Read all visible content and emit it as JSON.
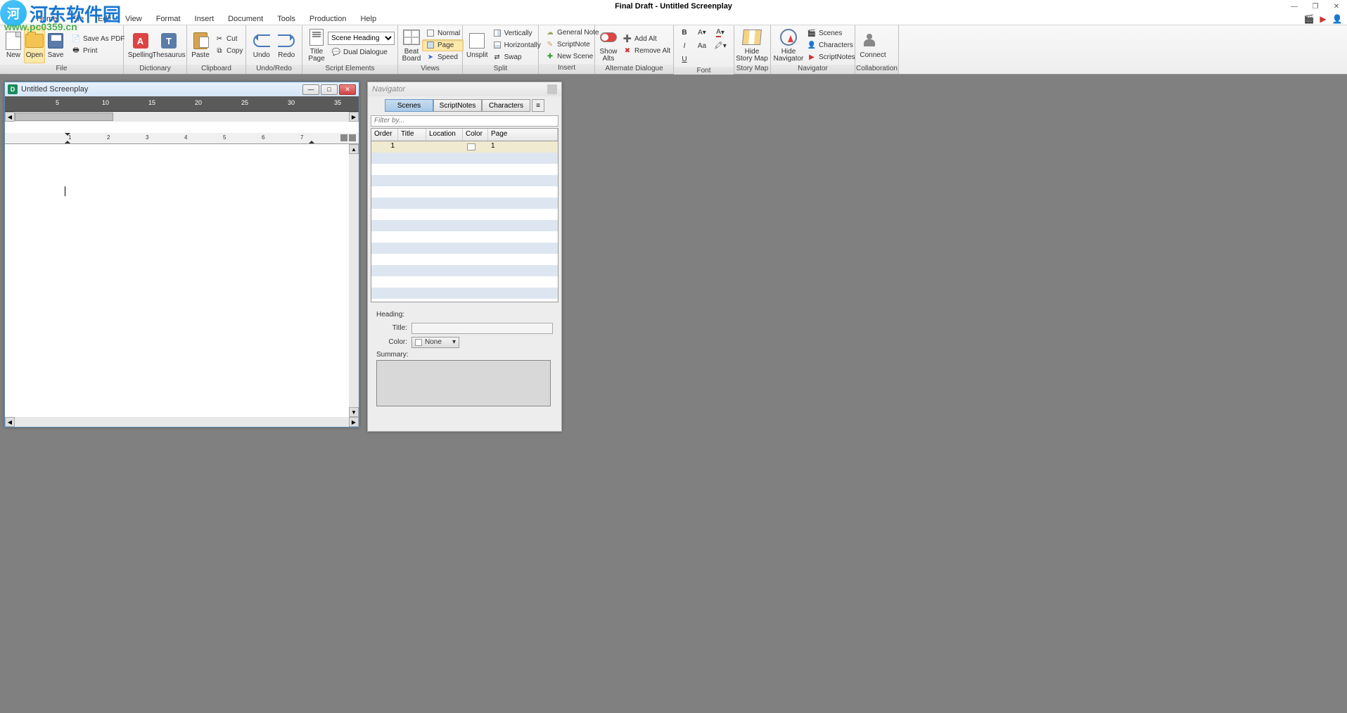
{
  "app": {
    "title": "Final Draft - Untitled Screenplay"
  },
  "watermark": {
    "brand": "河东软件园",
    "url": "www.pc0359.cn"
  },
  "menu": {
    "items": [
      "Home",
      "File",
      "Edit",
      "View",
      "Format",
      "Insert",
      "Document",
      "Tools",
      "Production",
      "Help"
    ]
  },
  "ribbon": {
    "file": {
      "label": "File",
      "new": "New",
      "open": "Open",
      "save": "Save",
      "save_as_pdf": "Save As PDF",
      "print": "Print"
    },
    "dictionary": {
      "label": "Dictionary",
      "spelling": "Spelling",
      "thesaurus": "Thesaurus"
    },
    "clipboard": {
      "label": "Clipboard",
      "paste": "Paste",
      "cut": "Cut",
      "copy": "Copy"
    },
    "undoredo": {
      "label": "Undo/Redo",
      "undo": "Undo",
      "redo": "Redo"
    },
    "script_elements": {
      "label": "Script Elements",
      "title_page": "Title\nPage",
      "element_select": "Scene Heading",
      "dual_dialogue": "Dual Dialogue"
    },
    "views": {
      "label": "Views",
      "beat_board": "Beat\nBoard",
      "normal": "Normal",
      "page": "Page",
      "speed": "Speed"
    },
    "split": {
      "label": "Split",
      "unsplit": "Unsplit",
      "vertically": "Vertically",
      "horizontally": "Horizontally",
      "swap": "Swap"
    },
    "insert": {
      "label": "Insert",
      "general_note": "General Note",
      "script_note": "ScriptNote",
      "new_scene": "New Scene"
    },
    "alternate_dialogue": {
      "label": "Alternate Dialogue",
      "show_alts": "Show\nAlts",
      "add_alt": "Add Alt",
      "remove_alt": "Remove Alt"
    },
    "font": {
      "label": "Font"
    },
    "story_map": {
      "label": "Story Map",
      "hide": "Hide\nStory Map"
    },
    "navigator": {
      "label": "Navigator",
      "hide_nav": "Hide\nNavigator",
      "scenes": "Scenes",
      "characters": "Characters",
      "scriptnotes": "ScriptNotes"
    },
    "collaboration": {
      "label": "Collaboration",
      "connect": "Connect"
    }
  },
  "doc": {
    "title": "Untitled Screenplay",
    "ruler_top": [
      "5",
      "10",
      "15",
      "20",
      "25",
      "30",
      "35"
    ],
    "ruler2": [
      "1",
      "2",
      "3",
      "4",
      "5",
      "6",
      "7"
    ]
  },
  "navigator_panel": {
    "title": "Navigator",
    "tabs": {
      "scenes": "Scenes",
      "scriptnotes": "ScriptNotes",
      "characters": "Characters"
    },
    "filter_placeholder": "Filter by...",
    "columns": {
      "order": "Order",
      "title": "Title",
      "location": "Location",
      "color": "Color",
      "page": "Page"
    },
    "rows": [
      {
        "order": "1",
        "title": "",
        "location": "",
        "page": "1"
      }
    ],
    "heading": "Heading:",
    "title_label": "Title:",
    "color_label": "Color:",
    "color_value": "None",
    "summary_label": "Summary:"
  }
}
